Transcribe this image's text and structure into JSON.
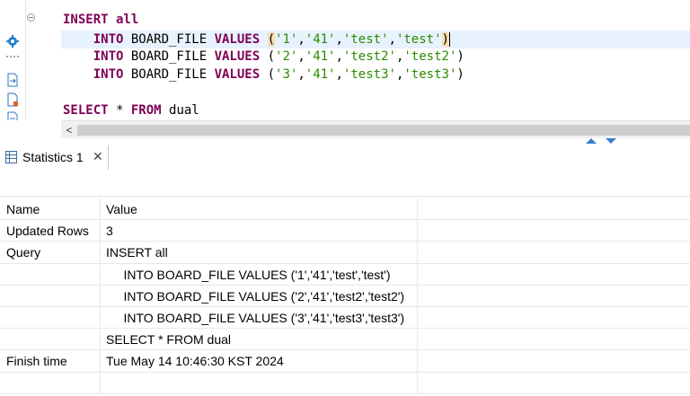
{
  "editor": {
    "lines": [
      {
        "tokens": [
          {
            "t": "INSERT all",
            "c": "kw"
          }
        ]
      },
      {
        "tokens": [
          {
            "t": "    INTO ",
            "c": "kw"
          },
          {
            "t": "BOARD_FILE ",
            "c": "ident"
          },
          {
            "t": "VALUES ",
            "c": "kw"
          },
          {
            "t": "(",
            "c": "paren-hl"
          },
          {
            "t": "'1'",
            "c": "str"
          },
          {
            "t": ",",
            "c": "ident"
          },
          {
            "t": "'41'",
            "c": "str"
          },
          {
            "t": ",",
            "c": "ident"
          },
          {
            "t": "'test'",
            "c": "str"
          },
          {
            "t": ",",
            "c": "ident"
          },
          {
            "t": "'test'",
            "c": "str"
          },
          {
            "t": ")",
            "c": "paren-hl"
          }
        ],
        "current": true
      },
      {
        "tokens": [
          {
            "t": "    INTO ",
            "c": "kw"
          },
          {
            "t": "BOARD_FILE ",
            "c": "ident"
          },
          {
            "t": "VALUES ",
            "c": "kw"
          },
          {
            "t": "(",
            "c": "ident"
          },
          {
            "t": "'2'",
            "c": "str"
          },
          {
            "t": ",",
            "c": "ident"
          },
          {
            "t": "'41'",
            "c": "str"
          },
          {
            "t": ",",
            "c": "ident"
          },
          {
            "t": "'test2'",
            "c": "str"
          },
          {
            "t": ",",
            "c": "ident"
          },
          {
            "t": "'test2'",
            "c": "str"
          },
          {
            "t": ")",
            "c": "ident"
          }
        ]
      },
      {
        "tokens": [
          {
            "t": "    INTO ",
            "c": "kw"
          },
          {
            "t": "BOARD_FILE ",
            "c": "ident"
          },
          {
            "t": "VALUES ",
            "c": "kw"
          },
          {
            "t": "(",
            "c": "ident"
          },
          {
            "t": "'3'",
            "c": "str"
          },
          {
            "t": ",",
            "c": "ident"
          },
          {
            "t": "'41'",
            "c": "str"
          },
          {
            "t": ",",
            "c": "ident"
          },
          {
            "t": "'test3'",
            "c": "str"
          },
          {
            "t": ",",
            "c": "ident"
          },
          {
            "t": "'test3'",
            "c": "str"
          },
          {
            "t": ")",
            "c": "ident"
          }
        ]
      },
      {
        "tokens": []
      },
      {
        "tokens": [
          {
            "t": "SELECT",
            "c": "kw"
          },
          {
            "t": " * ",
            "c": "ident"
          },
          {
            "t": "FROM",
            "c": "kw"
          },
          {
            "t": " dual",
            "c": "ident"
          }
        ]
      }
    ]
  },
  "scrollbar": {
    "left_arrow": "<"
  },
  "tab": {
    "label": "Statistics 1",
    "close": "✕"
  },
  "grid": {
    "rows": [
      [
        "Name",
        "Value"
      ],
      [
        "Updated Rows",
        "3"
      ],
      [
        "Query",
        "INSERT all"
      ],
      [
        "",
        "     INTO BOARD_FILE VALUES ('1','41','test','test')"
      ],
      [
        "",
        "     INTO BOARD_FILE VALUES ('2','41','test2','test2')"
      ],
      [
        "",
        "     INTO BOARD_FILE VALUES ('3','41','test3','test3')"
      ],
      [
        "",
        "SELECT * FROM dual"
      ],
      [
        "Finish time",
        "Tue May 14 10:46:30 KST 2024"
      ],
      [
        "",
        ""
      ]
    ]
  },
  "colors": {
    "keyword": "#7f0055",
    "string": "#2a8a00",
    "current_line": "#e8f2fe",
    "paren_highlight": "#f5deb3"
  }
}
